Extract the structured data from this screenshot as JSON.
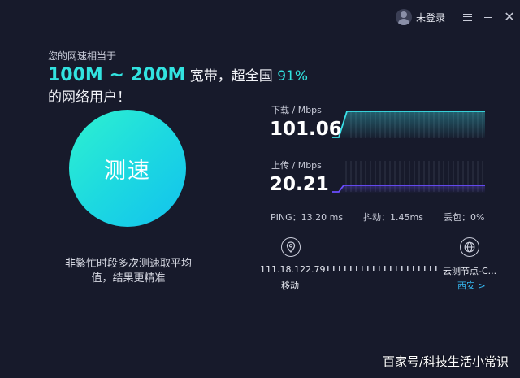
{
  "header": {
    "login_label": "未登录",
    "menu_icon": "menu-icon",
    "minimize_icon": "minimize-icon",
    "close_icon": "close-icon"
  },
  "result": {
    "equiv_label": "您的网速相当于",
    "bandwidth": "100M ~ 200M",
    "text_broadband": " 宽带，超全国 ",
    "percent": "91%",
    "text_tail": " 的网络用户！"
  },
  "test_button": {
    "label": "测速"
  },
  "tip": "非繁忙时段多次测速取平均值，结果更精准",
  "download": {
    "label": "下载 / Mbps",
    "value": "101.06",
    "color": "#3ae0e8"
  },
  "upload": {
    "label": "上传 / Mbps",
    "value": "20.21",
    "color": "#6a4cff"
  },
  "stats": {
    "ping": "PING：13.20 ms",
    "jitter": "抖动：1.45ms",
    "loss": "丢包：0%"
  },
  "client": {
    "ip": "111.18.122.79",
    "isp": "移动",
    "icon": "location-pin-icon"
  },
  "server": {
    "name": "云测节点-C...",
    "city": "西安 >",
    "icon": "globe-icon"
  },
  "watermark": "百家号/科技生活小常识"
}
